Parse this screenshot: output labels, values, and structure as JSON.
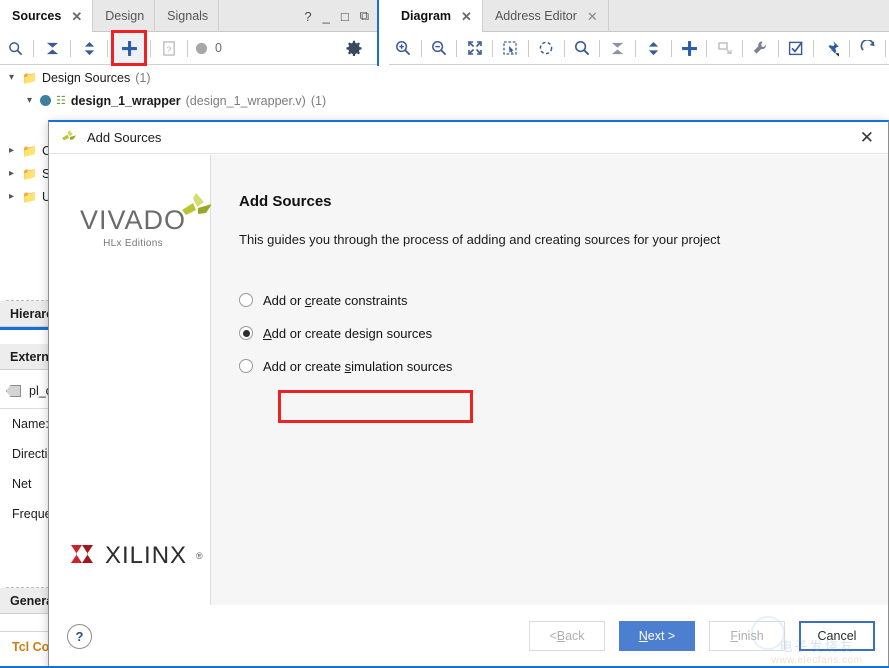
{
  "left_panel": {
    "tabs": [
      {
        "label": "Sources",
        "active": true,
        "closable": true
      },
      {
        "label": "Design",
        "active": false,
        "closable": false
      },
      {
        "label": "Signals",
        "active": false,
        "closable": false
      }
    ],
    "window_buttons": [
      "?",
      "_",
      "□",
      "⧉"
    ],
    "toolbar": {
      "items": [
        {
          "name": "search-icon",
          "glyph": "⌕",
          "enabled": true
        },
        {
          "name": "collapse-all-icon",
          "glyph": "⧨",
          "enabled": true
        },
        {
          "name": "expand-all-icon",
          "glyph": "⇅",
          "enabled": true
        },
        {
          "name": "add-sources-icon",
          "glyph": "+",
          "enabled": true,
          "highlighted": true
        },
        {
          "name": "report-icon",
          "glyph": "⍰",
          "enabled": false
        },
        {
          "name": "status-dot-icon",
          "glyph": "●",
          "enabled": false
        }
      ],
      "counter": "0",
      "settings_glyph": "⚙"
    },
    "tree": [
      {
        "label": "Design Sources",
        "count": "(1)",
        "expanded": true,
        "indent": 0
      },
      {
        "label": "design_1_wrapper",
        "file": "(design_1_wrapper.v)",
        "count": "(1)",
        "expanded": true,
        "indent": 1
      },
      {
        "label": "Co",
        "expanded": false,
        "indent": 0
      },
      {
        "label": "Si",
        "expanded": false,
        "indent": 0
      },
      {
        "label": "Ut",
        "expanded": false,
        "indent": 0
      }
    ],
    "hierarchy_tab": "Hierarc",
    "external_section": "External",
    "port_item": "pl_clk",
    "properties": [
      "Name:",
      "Directio",
      "Net",
      "Freque"
    ],
    "general_tab": "General",
    "tcl_console_tab": "Tcl Cons"
  },
  "right_panel": {
    "tabs": [
      {
        "label": "Diagram",
        "active": true,
        "closable": true
      },
      {
        "label": "Address Editor",
        "active": false,
        "closable": true
      }
    ],
    "toolbar": {
      "items": [
        {
          "name": "zoom-in-icon",
          "glyph": "⊕",
          "enabled": true
        },
        {
          "name": "zoom-out-icon",
          "glyph": "⊖",
          "enabled": true
        },
        {
          "name": "zoom-fit-icon",
          "glyph": "⤡",
          "enabled": true
        },
        {
          "name": "zoom-area-icon",
          "glyph": "⬚",
          "enabled": true
        },
        {
          "name": "refresh-layout-icon",
          "glyph": "◌",
          "enabled": true
        },
        {
          "name": "search-icon",
          "glyph": "⌕",
          "enabled": true
        },
        {
          "name": "collapse-all-icon",
          "glyph": "⧨",
          "enabled": true
        },
        {
          "name": "expand-all-icon",
          "glyph": "⇅",
          "enabled": true
        },
        {
          "name": "add-ip-icon",
          "glyph": "+",
          "enabled": true
        },
        {
          "name": "add-module-icon",
          "glyph": "⬚",
          "enabled": false
        },
        {
          "name": "run-connection-automation-icon",
          "glyph": "⚒",
          "enabled": true
        },
        {
          "name": "validate-design-icon",
          "glyph": "☑",
          "enabled": true
        },
        {
          "name": "pin-icon",
          "glyph": "★",
          "enabled": true
        },
        {
          "name": "regenerate-layout-icon",
          "glyph": "↻",
          "enabled": true
        }
      ]
    }
  },
  "dialog": {
    "title": "Add Sources",
    "close_glyph": "✕",
    "branding": {
      "vivado_word": "VIVADO",
      "vivado_sub": "HLx Editions",
      "xilinx_name": "XILINX",
      "xilinx_reg": "®"
    },
    "heading": "Add Sources",
    "description": "This guides you through the process of adding and creating sources for your project",
    "options": [
      {
        "id": "constraints",
        "pre": "Add or ",
        "mnemonic": "c",
        "post": "reate constraints",
        "selected": false
      },
      {
        "id": "design-sources",
        "pre": "",
        "mnemonic": "A",
        "post": "dd or create design sources",
        "selected": true,
        "highlighted": true
      },
      {
        "id": "simulation-sources",
        "pre": "Add or create ",
        "mnemonic": "s",
        "post": "imulation sources",
        "selected": false
      }
    ],
    "footer": {
      "help_glyph": "?",
      "buttons": [
        {
          "name": "back-button",
          "pre": "< ",
          "mnemonic": "B",
          "post": "ack",
          "state": "disabled"
        },
        {
          "name": "next-button",
          "pre": "",
          "mnemonic": "N",
          "post": "ext >",
          "state": "primary"
        },
        {
          "name": "finish-button",
          "pre": "",
          "mnemonic": "F",
          "post": "inish",
          "state": "disabled"
        },
        {
          "name": "cancel-button",
          "pre": "",
          "mnemonic": "",
          "post": "Cancel",
          "state": "focus"
        }
      ]
    }
  },
  "watermark": {
    "line1": "电子发烧友",
    "line2": "www.elecfans.com"
  },
  "colors": {
    "accent_blue": "#1a6fd4",
    "primary_button": "#4c7fd0",
    "highlight_red": "#ee2222",
    "toolbar_icon": "#3c5a96",
    "xilinx_red": "#cc2229",
    "vivado_green": "#b9c430"
  }
}
